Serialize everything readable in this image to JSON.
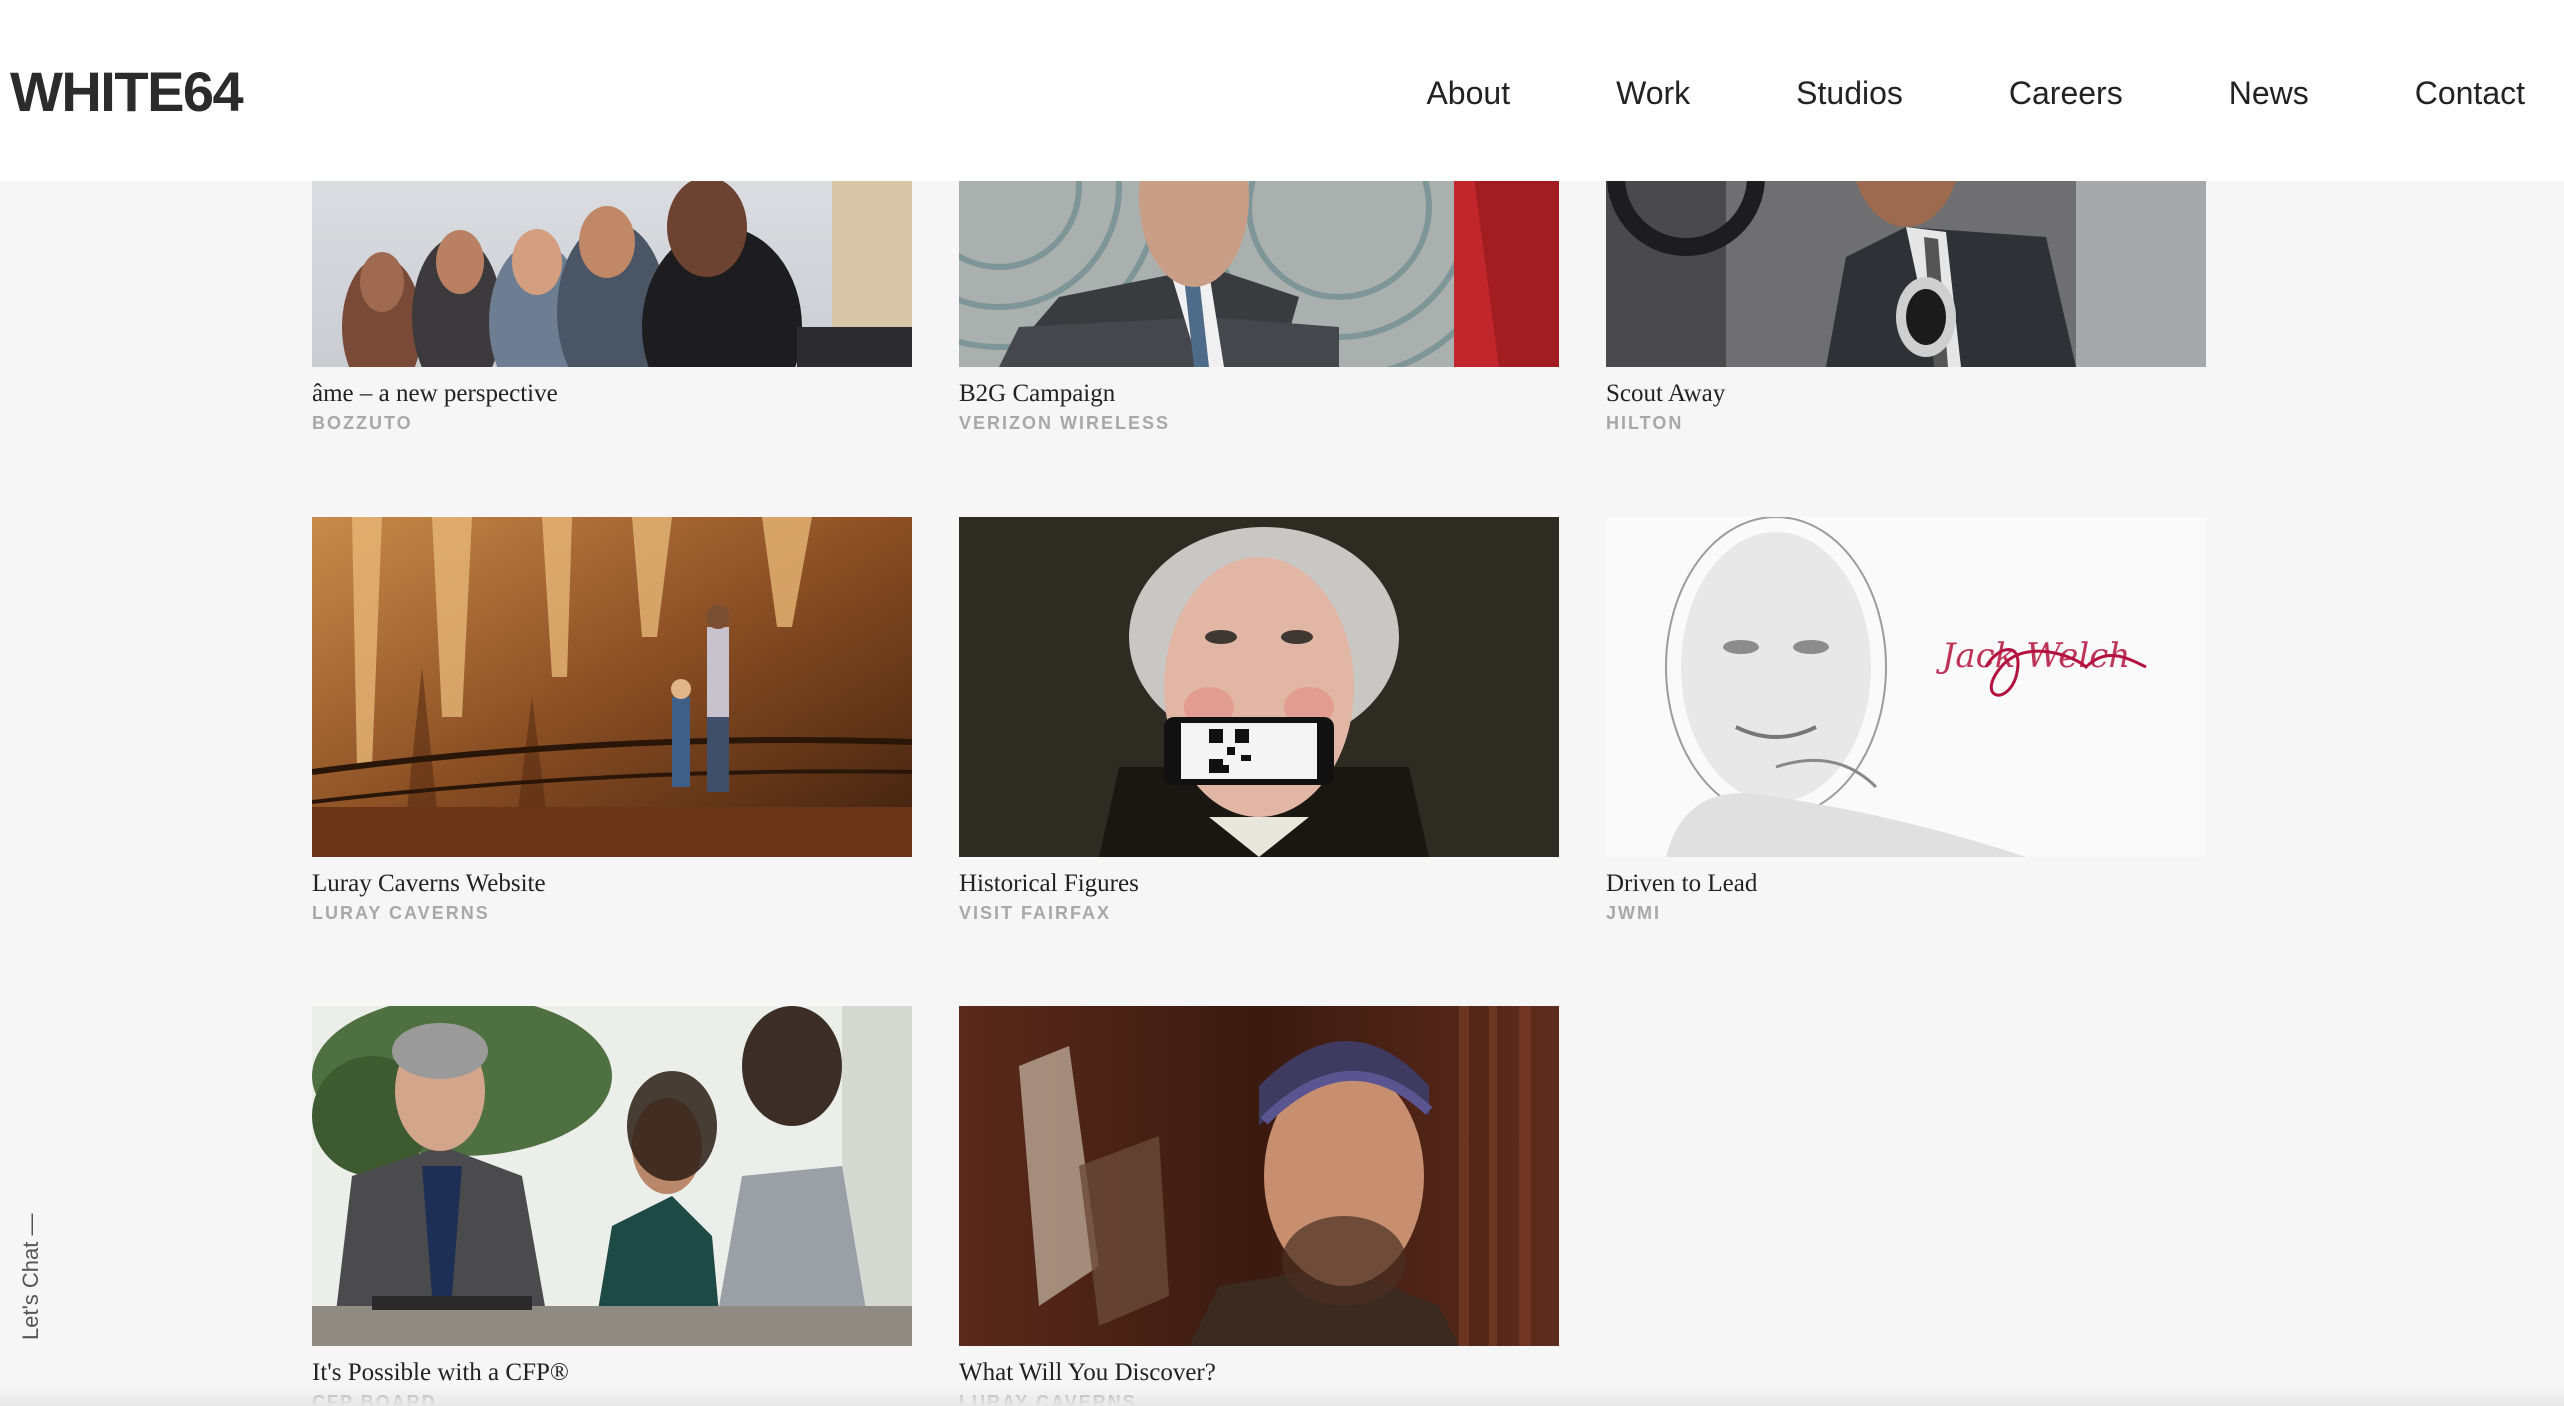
{
  "header": {
    "logo": "WHITE64",
    "nav": [
      "About",
      "Work",
      "Studios",
      "Careers",
      "News",
      "Contact"
    ]
  },
  "projects": [
    {
      "title": "âme – a new perspective",
      "client": "BOZZUTO"
    },
    {
      "title": "B2G Campaign",
      "client": "VERIZON WIRELESS"
    },
    {
      "title": "Scout Away",
      "client": "HILTON"
    },
    {
      "title": "Luray Caverns Website",
      "client": "LURAY CAVERNS"
    },
    {
      "title": "Historical Figures",
      "client": "VISIT FAIRFAX"
    },
    {
      "title": "Driven to Lead",
      "client": "JWMI"
    },
    {
      "title": "It's Possible with a CFP®",
      "client": "CFP BOARD"
    },
    {
      "title": "What Will You Discover?",
      "client": "LURAY CAVERNS"
    }
  ],
  "side_chat": "Let's Chat —",
  "signature_text": "Jack Welch"
}
